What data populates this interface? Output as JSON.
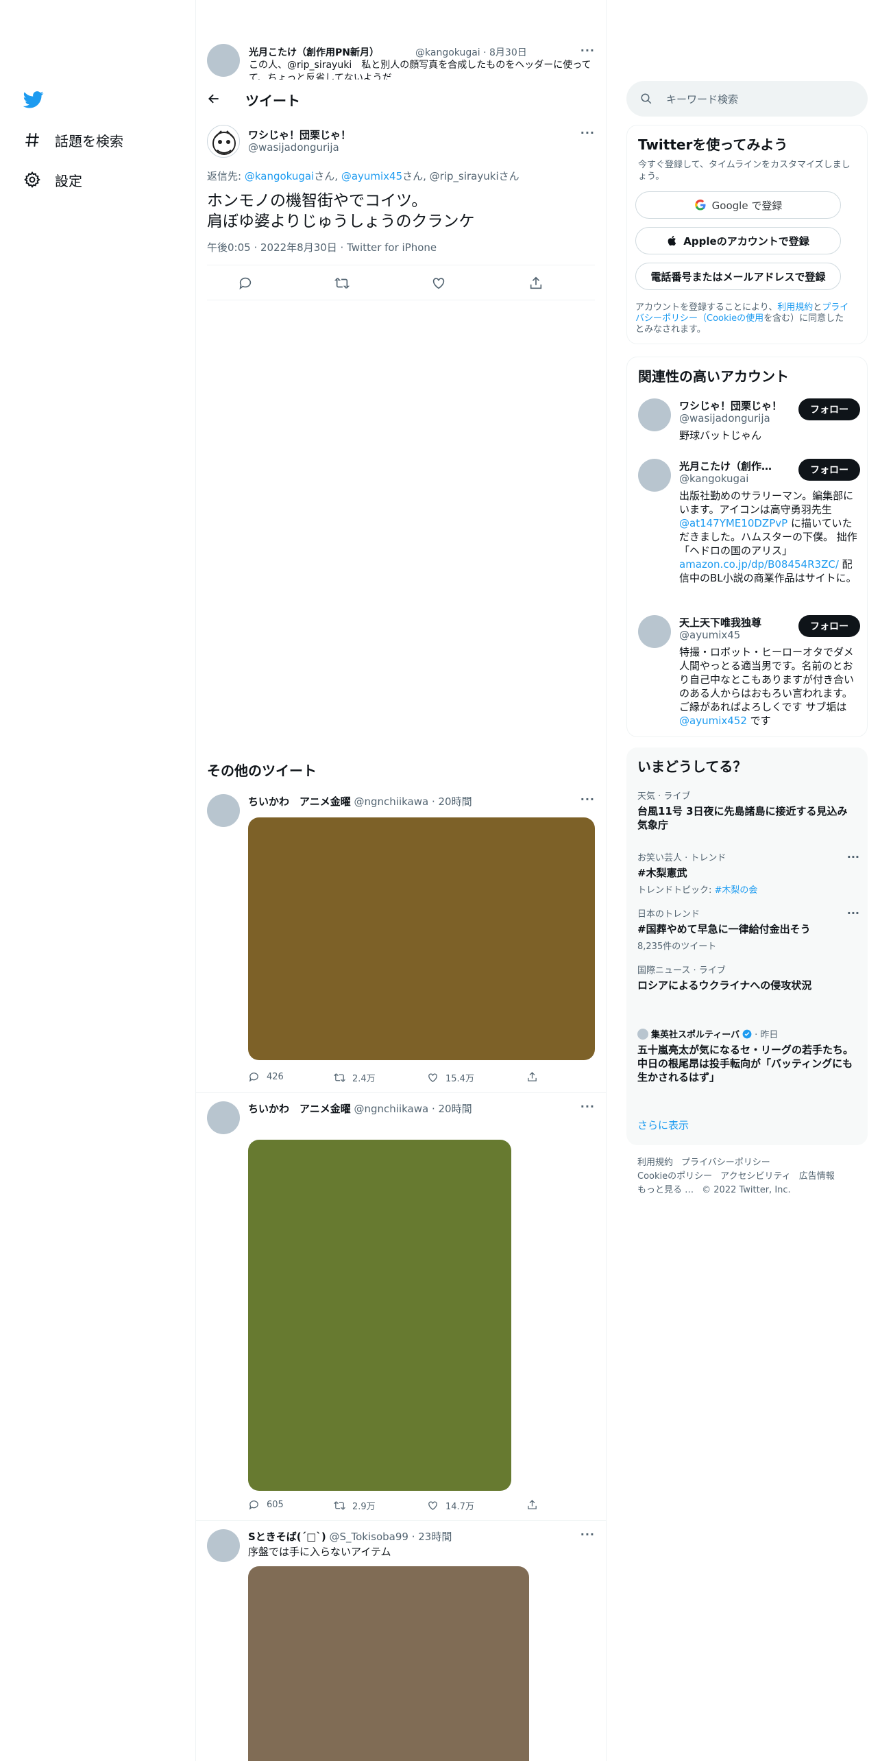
{
  "nav": {
    "explore_label": "話題を検索",
    "settings_label": "設定"
  },
  "prev_tweet": {
    "name": "光月こたけ（創作用PN新月）",
    "handle_time": "@kangokugai · 8月30日",
    "text": "この人、@rip_sirayuki　私と別人の顔写真を合成したものをヘッダーに使ってて、ちょっと反省してないようだ"
  },
  "header": {
    "title": "ツイート"
  },
  "main_tweet": {
    "name": "ワシじゃ！団栗じゃ！",
    "handle": "@wasijadongurija",
    "reply_prefix": "返信先: ",
    "reply_user1": "@kangokugai",
    "reply_san1": "さん, ",
    "reply_user2": "@ayumix45",
    "reply_san2": "さん, @rip_sirayukiさん",
    "text_line1": "ホンモノの機智街やでコイツ。",
    "text_line2": "肩ぼゆ婆よりじゅうしょうのクランケ",
    "meta": "午後0:05 · 2022年8月30日 · Twitter for iPhone"
  },
  "more_tweets_title": "その他のツイート",
  "feed": [
    {
      "name": "ちいかわ　アニメ金曜",
      "handle_time": "@ngnchiikawa · 20時間",
      "text": "",
      "media_color": "#7d6128",
      "replies": "426",
      "retweets": "2.4万",
      "likes": "15.4万"
    },
    {
      "name": "ちいかわ　アニメ金曜",
      "handle_time": "@ngnchiikawa · 20時間",
      "text": "",
      "media_color": "#677a30",
      "replies": "605",
      "retweets": "2.9万",
      "likes": "14.7万"
    },
    {
      "name": "Sときそば(´□`)",
      "handle_time": "@S_Tokisoba99 · 23時間",
      "text": "序盤では手に入らないアイテム",
      "media_color": "#806c55",
      "replies": "",
      "retweets": "",
      "likes": ""
    }
  ],
  "search": {
    "placeholder": "キーワード検索"
  },
  "signup": {
    "title": "Twitterを使ってみよう",
    "subtitle": "今すぐ登録して、タイムラインをカスタマイズしましょう。",
    "google_label": "Google で登録",
    "apple_label": "Appleのアカウントで登録",
    "phone_label": "電話番号またはメールアドレスで登録",
    "legal_prefix": "アカウントを登録することにより、",
    "legal_terms": "利用規約",
    "legal_and": "と",
    "legal_privacy": "プライバシーポリシー",
    "legal_cookie": "（Cookieの使用",
    "legal_suffix": "を含む）に同意したとみなされます。"
  },
  "related": {
    "title": "関連性の高いアカウント",
    "follow_label": "フォロー",
    "accounts": [
      {
        "name": "ワシじゃ！団栗じゃ！",
        "handle": "@wasijadongurija",
        "bio": "野球バットじゃん"
      },
      {
        "name": "光月こたけ（創作用PN新月）",
        "handle": "@kangokugai",
        "bio_1": "出版社勤めのサラリーマン。編集部にいます。アイコンは高守勇羽先生",
        "bio_link1": "@at147YME10DZPvP",
        "bio_2": " に描いていただきました。ハムスターの下僕。 拙作「ヘドロの国のアリス」",
        "bio_link2": "amazon.co.jp/dp/B08454R3ZC/",
        "bio_3": " 配信中のBL小説の商業作品はサイトに。"
      },
      {
        "name": "天上天下唯我独尊",
        "handle": "@ayumix45",
        "bio_1": "特撮・ロボット・ヒーローオタでダメ人間やっとる適当男です。名前のとおり自己中なとこもありますが付き合いのある人からはおもろい言われます。ご縁があればよろしくです サブ垢は",
        "bio_link": "@ayumix452",
        "bio_2": " です"
      }
    ]
  },
  "trends": {
    "title": "いまどうしてる？",
    "items": [
      {
        "category": "天気 · ライブ",
        "title": "台風11号 3日夜に先島諸島に接近する見込み 気象庁",
        "sub": ""
      },
      {
        "category": "お笑い芸人 · トレンド",
        "title": "#木梨憲武",
        "sub_prefix": "トレンドトピック: ",
        "sub_link": "#木梨の会"
      },
      {
        "category": "日本のトレンド",
        "title": "#国葬やめて早急に一律給付金出そう",
        "sub": "8,235件のツイート"
      },
      {
        "category": "国際ニュース · ライブ",
        "title": "ロシアによるウクライナへの侵攻状況",
        "sub": ""
      },
      {
        "category_name": "集英社スポルティーバ",
        "category_time": " · 昨日",
        "title": "五十嵐亮太が気になるセ・リーグの若手たち。中日の根尾昂は投手転向が「バッティングにも生かされるはず」",
        "sub": ""
      }
    ],
    "show_more": "さらに表示"
  },
  "footer": {
    "links": [
      "利用規約",
      "プライバシーポリシー",
      "Cookieのポリシー",
      "アクセシビリティ",
      "広告情報",
      "もっと見る …"
    ],
    "copyright": "© 2022 Twitter, Inc."
  },
  "colors": {
    "accent": "#1d9bf0",
    "text": "#0f1419",
    "muted": "#536471"
  }
}
